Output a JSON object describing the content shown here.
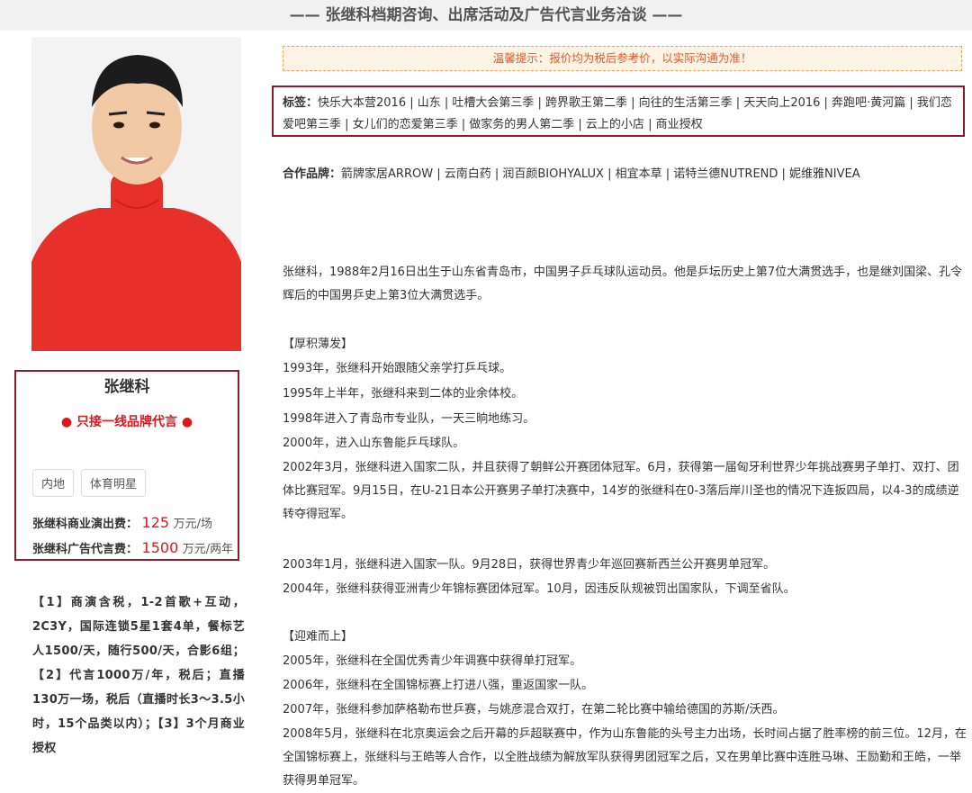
{
  "header": {
    "title": "—— 张继科档期咨询、出席活动及广告代言业务洽谈 ——"
  },
  "profile": {
    "name": "张继科",
    "motto": "● 只接一线品牌代言 ●",
    "tags": [
      "内地",
      "体育明星"
    ],
    "fee_show": {
      "label": "张继科商业演出费：",
      "value": "125",
      "unit": "万元/场"
    },
    "fee_ad": {
      "label": "张继科广告代言费：",
      "value": "1500",
      "unit": "万元/两年"
    },
    "colors": {
      "accent": "#e0161b",
      "border": "#8b1a2c"
    }
  },
  "notes": "【1】商演含税，1-2首歌+互动，2C3Y，国际连锁5星1套4单，餐标艺人1500/天，随行500/天，合影6组；【2】代言1000万/年，税后；直播130万一场，税后（直播时长3～3.5小时，15个品类以内）；【3】3个月商业授权",
  "notice": "温馨提示：报价均为税后参考价，以实际沟通为准！",
  "labels": {
    "key": "标签：",
    "text": "快乐大本营2016 | 山东 | 吐槽大会第三季 | 跨界歌王第二季 | 向往的生活第三季 | 天天向上2016 | 奔跑吧·黄河篇 | 我们恋爱吧第三季 | 女儿们的恋爱第三季 | 做家务的男人第二季 | 云上的小店 | 商业授权"
  },
  "brands": {
    "key": "合作品牌：",
    "text": "箭牌家居ARROW | 云南白药 | 润百颜BIOHYALUX | 相宜本草 | 诺特兰德NUTREND | 妮维雅NIVEA"
  },
  "bio": {
    "intro": "张继科，1988年2月16日出生于山东省青岛市，中国男子乒乓球队运动员。他是乒坛历史上第7位大满贯选手，也是继刘国梁、孔令辉后的中国男乒史上第3位大满贯选手。",
    "section1_title": "【厚积薄发】",
    "s1p1": "1993年，张继科开始跟随父亲学打乒乓球。",
    "s1p2": "1995年上半年，张继科来到二体的业余体校。",
    "s1p3": "1998年进入了青岛市专业队，一天三晌地练习。",
    "s1p4": "2000年，进入山东鲁能乒乓球队。",
    "s1p5": "2002年3月，张继科进入国家二队，并且获得了朝鲜公开赛团体冠军。6月，获得第一届匈牙利世界少年挑战赛男子单打、双打、团体比赛冠军。9月15日，在U-21日本公开赛男子单打决赛中，14岁的张继科在0-3落后岸川圣也的情况下连扳四局，以4-3的成绩逆转夺得冠军。",
    "s1p6": "2003年1月，张继科进入国家一队。9月28日，获得世界青少年巡回赛新西兰公开赛男单冠军。",
    "s1p7": "2004年，张继科获得亚洲青少年锦标赛团体冠军。10月，因违反队规被罚出国家队，下调至省队。",
    "section2_title": "【迎难而上】",
    "s2p1": "2005年，张继科在全国优秀青少年调赛中获得单打冠军。",
    "s2p2": "2006年，张继科在全国锦标赛上打进八强，重返国家一队。",
    "s2p3": "2007年，张继科参加萨格勒布世乒赛，与姚彦混合双打，在第二轮比赛中输给德国的苏斯/沃西。",
    "s2p4": "2008年5月，张继科在北京奥运会之后开幕的乒超联赛中，作为山东鲁能的头号主力出场，长时间占据了胜率榜的前三位。12月，在全国锦标赛上，张继科与王皓等人合作，以全胜战绩为解放军队获得男团冠军之后，又在男单比赛中连胜马琳、王励勤和王皓，一举获得男单冠军。"
  }
}
